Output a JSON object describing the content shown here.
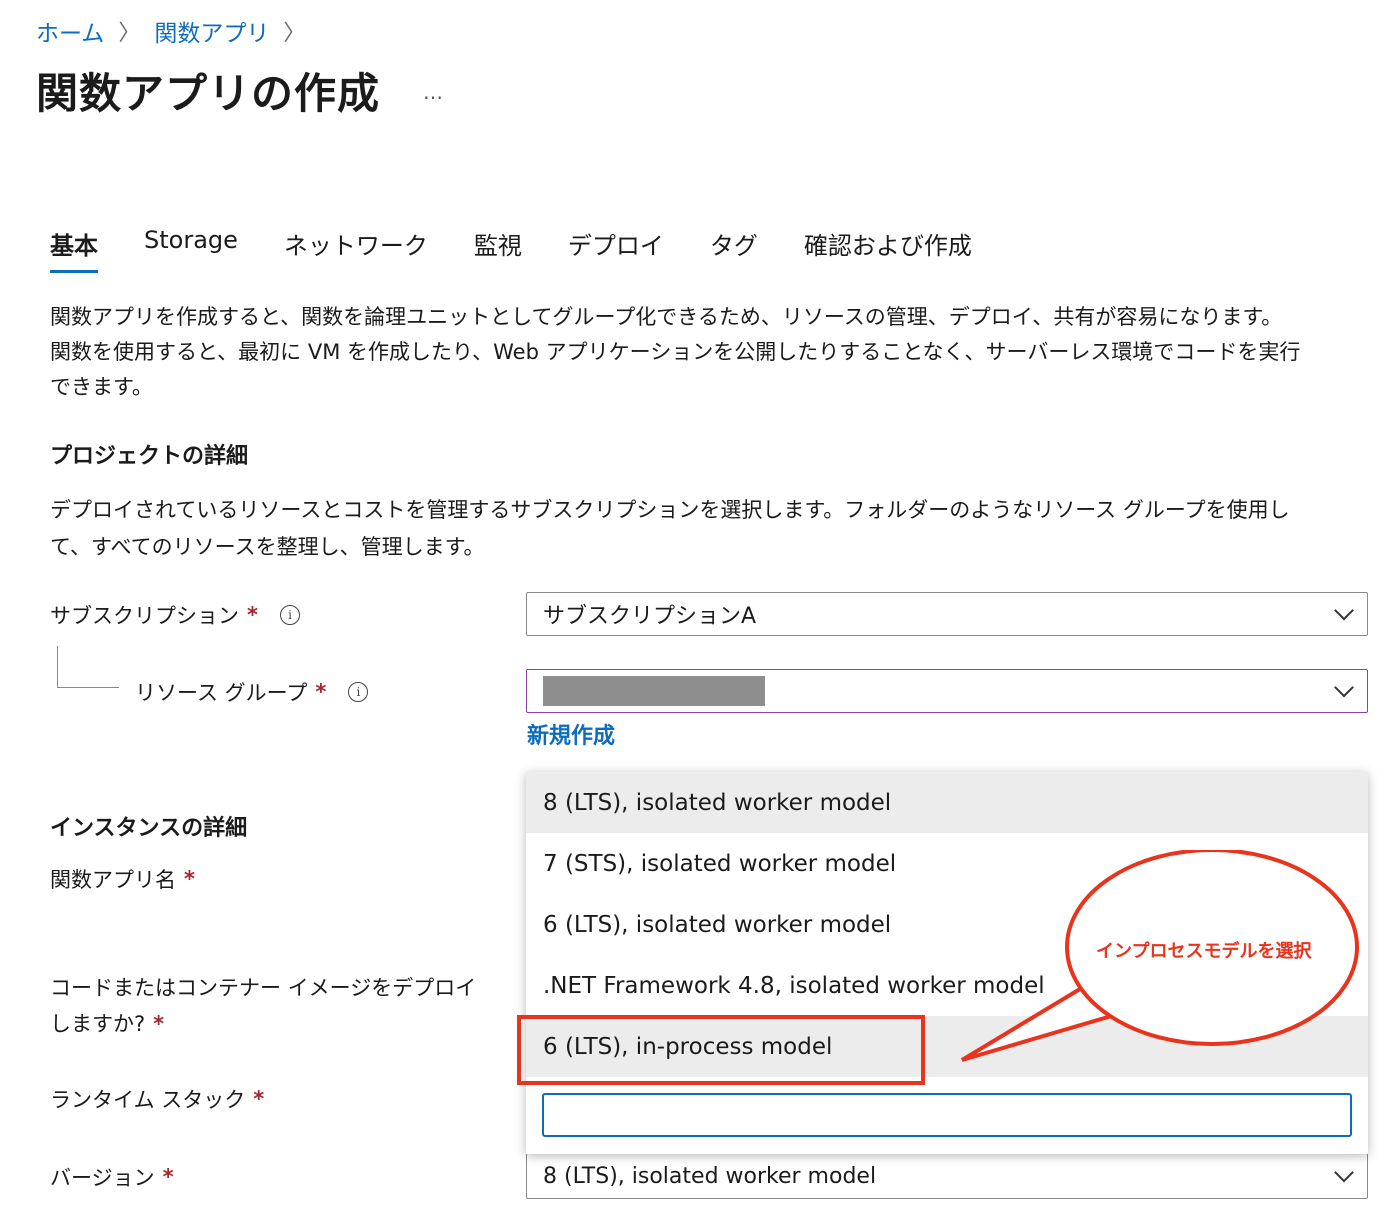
{
  "breadcrumb": {
    "home": "ホーム",
    "function_app": "関数アプリ",
    "sep": "〉"
  },
  "page": {
    "title": "関数アプリの作成",
    "more": "…"
  },
  "tabs": [
    {
      "label": "基本"
    },
    {
      "label": "Storage"
    },
    {
      "label": "ネットワーク"
    },
    {
      "label": "監視"
    },
    {
      "label": "デプロイ"
    },
    {
      "label": "タグ"
    },
    {
      "label": "確認および作成"
    }
  ],
  "intro": {
    "line1": "関数アプリを作成すると、関数を論理ユニットとしてグループ化できるため、リソースの管理、デプロイ、共有が容易になります。",
    "line2": "関数を使用すると、最初に VM を作成したり、Web アプリケーションを公開したりすることなく、サーバーレス環境でコードを実行",
    "line3": "できます。"
  },
  "project": {
    "heading": "プロジェクトの詳細",
    "desc_line1": "デプロイされているリソースとコストを管理するサブスクリプションを選択します。フォルダーのようなリソース グループを使用し",
    "desc_line2": "て、すべてのリソースを整理し、管理します。",
    "subscription_label": "サブスクリプション",
    "subscription_value": "サブスクリプションA",
    "resource_group_label": "リソース グループ",
    "new_link": "新規作成",
    "required": "*",
    "info": "i"
  },
  "instance": {
    "heading": "インスタンスの詳細",
    "app_name_label": "関数アプリ名",
    "deploy_label_line1": "コードまたはコンテナー イメージをデプロイ",
    "deploy_label_line2": "しますか?",
    "runtime_label": "ランタイム スタック",
    "version_label": "バージョン",
    "version_value": "8 (LTS), isolated worker model"
  },
  "dropdown": {
    "options": [
      "8 (LTS), isolated worker model",
      "7 (STS), isolated worker model",
      "6 (LTS), isolated worker model",
      ".NET Framework 4.8, isolated worker model",
      "6 (LTS), in-process model"
    ],
    "filter_value": ""
  },
  "annotation": {
    "callout": "インプロセスモデルを選択",
    "color": "#e8341d"
  },
  "colors": {
    "accent": "#0f6cbd",
    "required": "#a4262c",
    "focus_border": "#8b3fa8"
  }
}
